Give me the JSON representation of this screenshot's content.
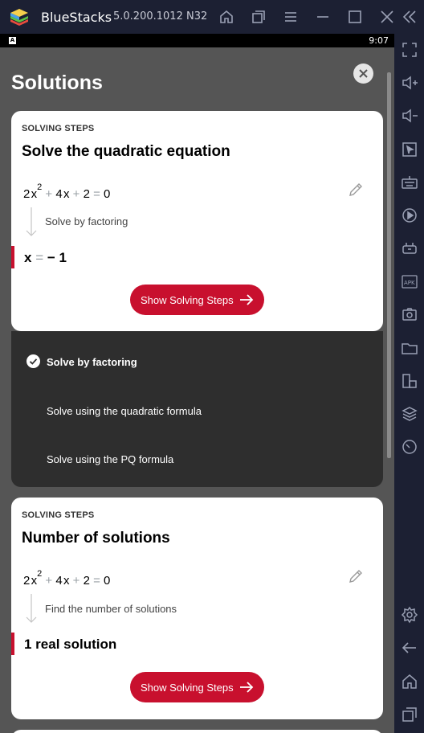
{
  "window": {
    "app_name": "BlueStacks",
    "version": "5.0.200.1012  N32"
  },
  "status": {
    "indicator": "A",
    "time": "9:07"
  },
  "page": {
    "title": "Solutions"
  },
  "card1": {
    "label": "SOLVING STEPS",
    "title": "Solve the quadratic equation",
    "equation": {
      "c1": "2",
      "v1": "x",
      "exp": "2",
      "op1": "+",
      "c2": "4",
      "v2": "x",
      "op2": "+",
      "c3": "2",
      "eq": "=",
      "rhs": "0"
    },
    "step": "Solve by factoring",
    "answer": {
      "var": "x",
      "eq": "=",
      "value": "− 1"
    },
    "button": "Show Solving Steps"
  },
  "methods": [
    {
      "label": "Solve by factoring",
      "selected": true
    },
    {
      "label": "Solve using the quadratic formula",
      "selected": false
    },
    {
      "label": "Solve using the PQ formula",
      "selected": false
    }
  ],
  "card2": {
    "label": "SOLVING STEPS",
    "title": "Number of solutions",
    "equation": {
      "c1": "2",
      "v1": "x",
      "exp": "2",
      "op1": "+",
      "c2": "4",
      "v2": "x",
      "op2": "+",
      "c3": "2",
      "eq": "=",
      "rhs": "0"
    },
    "step": "Find the number of solutions",
    "answer": "1 real solution",
    "button": "Show Solving Steps"
  },
  "colors": {
    "accent": "#c8102e",
    "frame": "#1c2033",
    "screen_bg": "#555555",
    "methods_bg": "#2e2e2e"
  },
  "icons": {
    "titlebar": [
      "home-icon",
      "multi-instance-icon",
      "menu-icon",
      "minimize-icon",
      "maximize-icon",
      "close-icon",
      "collapse-sidebar-icon"
    ],
    "sidebar": [
      "fullscreen-icon",
      "volume-up-icon",
      "volume-down-icon",
      "pointer-icon",
      "keyboard-icon",
      "macro-record-icon",
      "game-controls-icon",
      "apk-install-icon",
      "screenshot-icon",
      "folder-icon",
      "multi-instance-icon",
      "layers-icon",
      "eco-mode-icon",
      "settings-icon",
      "back-icon",
      "home-icon",
      "recent-apps-icon"
    ]
  }
}
